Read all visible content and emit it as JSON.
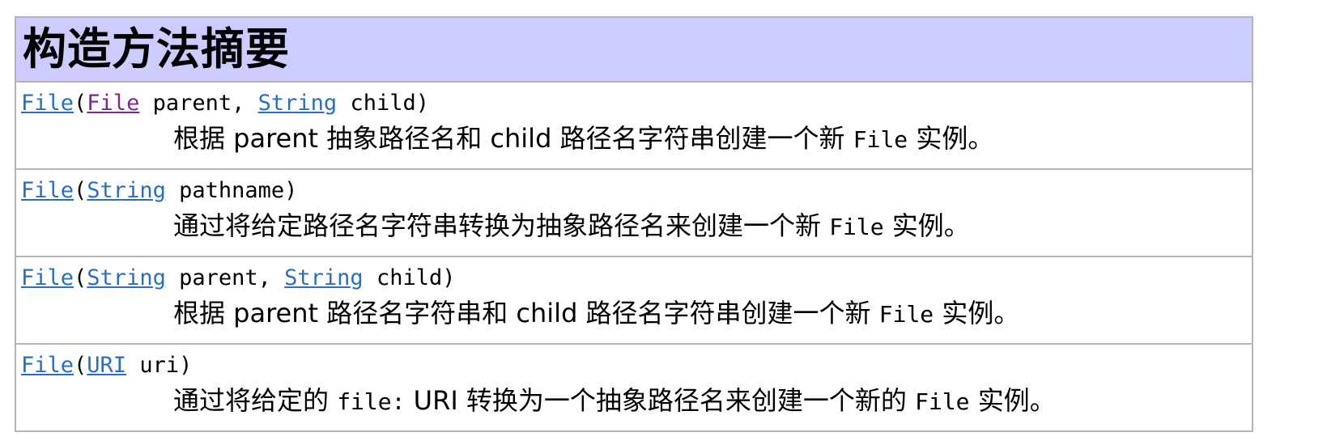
{
  "header": {
    "title": "构造方法摘要"
  },
  "colors": {
    "header_bg": "#ccccff",
    "border": "#b4b4b4",
    "link": "#2a6ebe",
    "visited_link": "#7a2a85"
  },
  "rows": [
    {
      "ctor": "File",
      "open": "(",
      "p1_type": "File",
      "p1_name": " parent, ",
      "p2_type": "String",
      "p2_name": " child",
      "close": ")",
      "desc_a": "根据 parent 抽象路径名和 child 路径名字符串创建一个新 ",
      "desc_code": "File",
      "desc_b": " 实例。"
    },
    {
      "ctor": "File",
      "open": "(",
      "p1_type": "String",
      "p1_name": " pathname",
      "close": ")",
      "desc_a": "通过将给定路径名字符串转换为抽象路径名来创建一个新 ",
      "desc_code": "File",
      "desc_b": " 实例。"
    },
    {
      "ctor": "File",
      "open": "(",
      "p1_type": "String",
      "p1_name": " parent, ",
      "p2_type": "String",
      "p2_name": " child",
      "close": ")",
      "desc_a": "根据 parent 路径名字符串和 child 路径名字符串创建一个新 ",
      "desc_code": "File",
      "desc_b": " 实例。"
    },
    {
      "ctor": "File",
      "open": "(",
      "p1_type": "URI",
      "p1_name": " uri",
      "close": ")",
      "desc_a": "通过将给定的 ",
      "desc_code_mid": "file:",
      "desc_mid": " URI 转换为一个抽象路径名来创建一个新的 ",
      "desc_code": "File",
      "desc_b": " 实例。"
    }
  ]
}
